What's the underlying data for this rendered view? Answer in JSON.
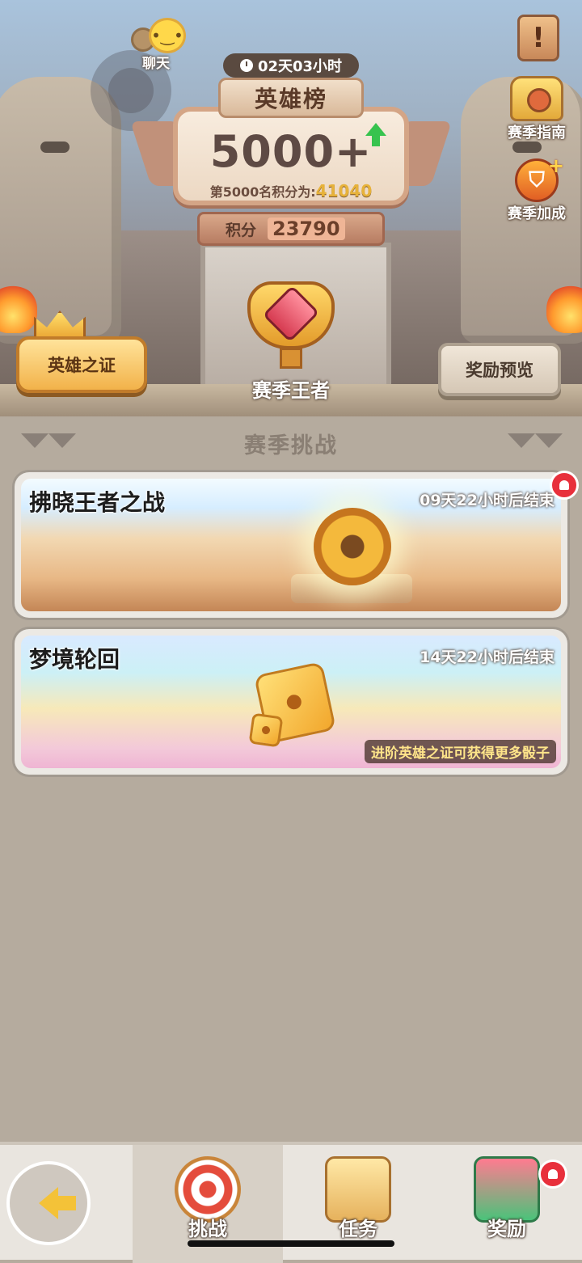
{
  "chat": {
    "label": "聊天"
  },
  "season_timer": "02天03小时",
  "leaderboard": {
    "title": "英雄榜",
    "rank": "5000+",
    "note_prefix": "第5000名积分为:",
    "note_value": "41040",
    "score_label": "积分",
    "score_value": "23790",
    "trend": "up"
  },
  "side_buttons": {
    "notice_glyph": "!",
    "season_guide": "赛季指南",
    "season_boost": "赛季加成"
  },
  "tier": {
    "label": "赛季王者"
  },
  "buttons": {
    "hero_proof": "英雄之证",
    "reward_preview": "奖励预览"
  },
  "challenges": {
    "section_title": "赛季挑战",
    "items": [
      {
        "title": "拂晓王者之战",
        "time": "09天22小时后结束",
        "hint": "",
        "has_alert": true
      },
      {
        "title": "梦境轮回",
        "time": "14天22小时后结束",
        "hint": "进阶英雄之证可获得更多骰子",
        "has_alert": false
      }
    ]
  },
  "nav": {
    "tabs": [
      {
        "label": "挑战",
        "icon": "target-icon",
        "active": true
      },
      {
        "label": "任务",
        "icon": "scroll-icon",
        "active": false
      },
      {
        "label": "奖励",
        "icon": "gift-icon",
        "active": false,
        "has_alert": true
      }
    ]
  },
  "colors": {
    "accent_gold": "#e7b23a",
    "alert_red": "#e8303c",
    "up_green": "#37c34e"
  }
}
